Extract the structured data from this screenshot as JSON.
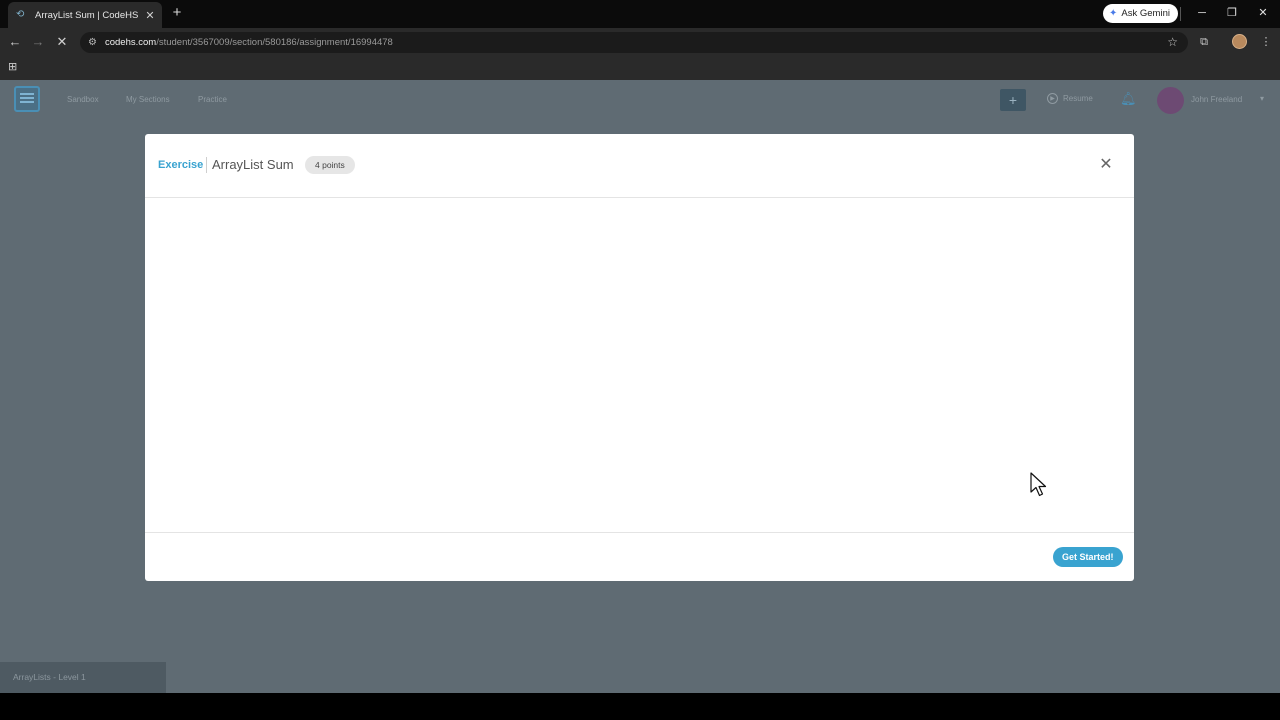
{
  "browser": {
    "tab_title": "ArrayList Sum | CodeHS",
    "ask_gemini": "Ask Gemini",
    "url_host": "codehs.com",
    "url_path": "/student/3567009/section/580186/assignment/16994478"
  },
  "header": {
    "nav": [
      "Sandbox",
      "My Sections",
      "Practice"
    ],
    "resume": "Resume",
    "user_name": "John Freeland"
  },
  "modal": {
    "kind": "Exercise",
    "title": "ArrayList Sum",
    "points": "4 points",
    "cta": "Get Started!"
  },
  "footer": {
    "section_label": "ArrayLists - Level 1"
  },
  "colors": {
    "accent": "#39a3d0",
    "overlay": "#5f6b73"
  }
}
